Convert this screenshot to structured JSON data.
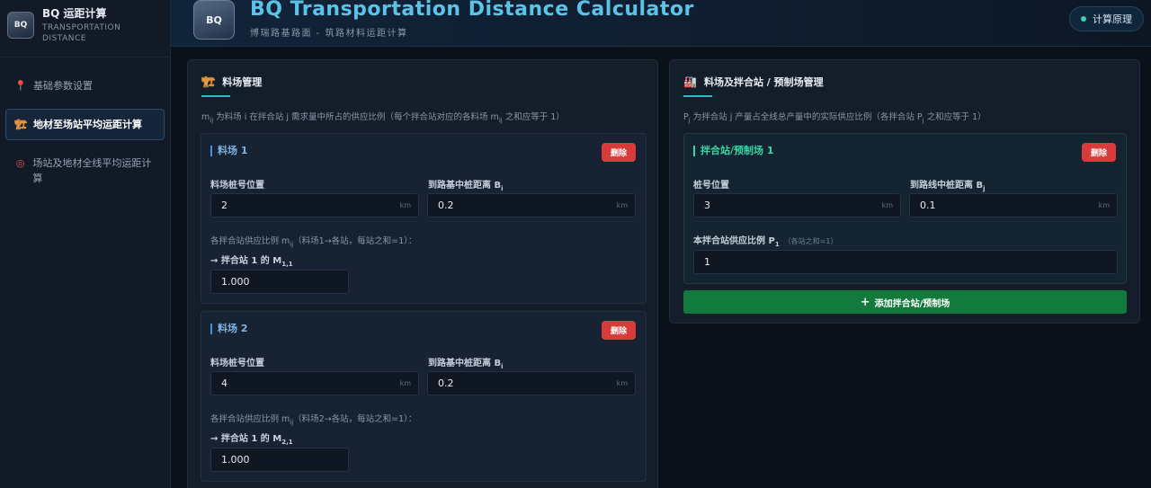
{
  "app": {
    "brand_title": "BQ 运距计算",
    "brand_sub_1": "TRANSPORTATION",
    "brand_sub_2": "DISTANCE",
    "logo_text": "BQ",
    "title": "BQ Transportation Distance Calculator",
    "subtitle": "博瑞路基路面   -   筑路材料运距计算",
    "principle_button": "计算原理"
  },
  "sidebar": {
    "items": [
      {
        "label": "基础参数设置",
        "icon": "pin-icon",
        "active": false
      },
      {
        "label": "地材至场站平均运距计算",
        "icon": "crane-icon",
        "active": true
      },
      {
        "label": "场站及地材全线平均运距计算",
        "icon": "target-icon",
        "active": false
      }
    ]
  },
  "quarry_panel": {
    "title": "料场管理",
    "desc_pre": "m",
    "desc_sub": "ij",
    "desc_mid": " 为料场 i 在拌合站 j 需求量中所占的供应比例（每个拌合站对应的各料场 m",
    "desc_sub2": "ij",
    "desc_end": " 之和应等于 1）",
    "delete_label": "删除",
    "unit": "km",
    "field_station_label": "料场桩号位置",
    "field_dist_label_pre": "到路基中桩距离 B",
    "field_dist_sub": "i",
    "ratio_label_pre": "各拌合站供应比例 m",
    "ratio_label_sub": "ij",
    "arrow_pre": "→ 拌合站 1 的 M",
    "quarries": [
      {
        "name": "料场 1",
        "station": "2",
        "distance": "0.2",
        "ratio_note": "（料场1→各站，每站之和=1）：",
        "m_sub": "1,1",
        "ratio_value": "1.000"
      },
      {
        "name": "料场 2",
        "station": "4",
        "distance": "0.2",
        "ratio_note": "（料场2→各站，每站之和=1）：",
        "m_sub": "2,1",
        "ratio_value": "1.000"
      }
    ]
  },
  "station_panel": {
    "title": "料场及拌合站 / 预制场管理",
    "desc_pre": "P",
    "desc_sub": "j",
    "desc_mid": " 为拌合站 j 产量占全线总产量中的实际供应比例（各拌合站 P",
    "desc_sub2": "j",
    "desc_end": " 之和应等于 1）",
    "station_name": "拌合站/预制场 1",
    "delete_label": "删除",
    "unit": "km",
    "field_station_label": "桩号位置",
    "field_dist_label_pre": "到路线中桩距离 B",
    "field_dist_sub": "j",
    "station": "3",
    "distance": "0.1",
    "supply_label_pre": "本拌合站供应比例 P",
    "supply_sub": "1",
    "supply_hint": "（各站之和=1）",
    "supply_value": "1",
    "add_button": "添加拌合站/预制场"
  }
}
